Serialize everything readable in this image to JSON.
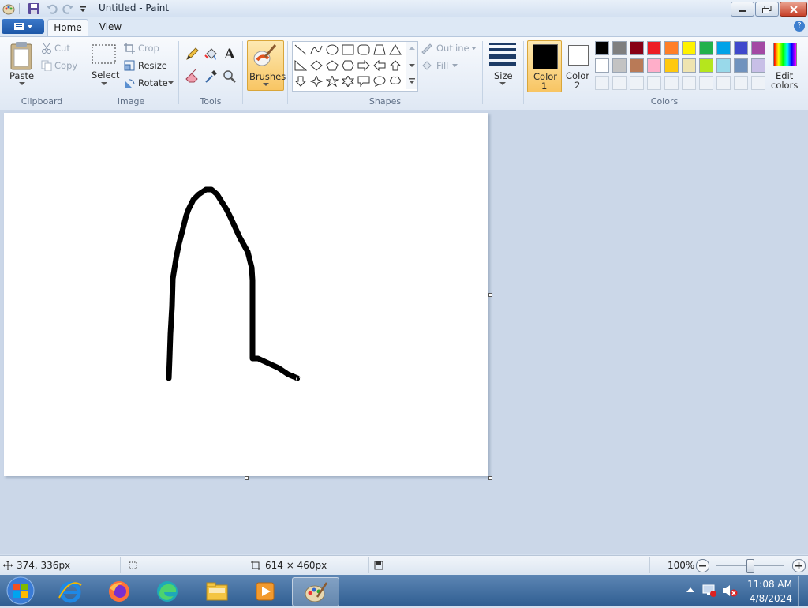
{
  "window": {
    "title": "Untitled - Paint"
  },
  "tabs": {
    "home": "Home",
    "view": "View"
  },
  "clipboard": {
    "paste": "Paste",
    "cut": "Cut",
    "copy": "Copy",
    "group": "Clipboard"
  },
  "image": {
    "select": "Select",
    "crop": "Crop",
    "resize": "Resize",
    "rotate": "Rotate",
    "group": "Image"
  },
  "tools": {
    "group": "Tools",
    "text_glyph": "A"
  },
  "brushes": {
    "label": "Brushes"
  },
  "shapes": {
    "outline": "Outline",
    "fill": "Fill",
    "group": "Shapes"
  },
  "size": {
    "label": "Size"
  },
  "colors": {
    "color1_line1": "Color",
    "color1_line2": "1",
    "color2_line1": "Color",
    "color2_line2": "2",
    "edit_line1": "Edit",
    "edit_line2": "colors",
    "group": "Colors",
    "color1": "#000000",
    "color2": "#ffffff",
    "palette_row1": [
      "#000000",
      "#7f7f7f",
      "#880015",
      "#ed1c24",
      "#ff7f27",
      "#fff200",
      "#22b14c",
      "#00a2e8",
      "#3f48cc",
      "#a349a4"
    ],
    "palette_row2": [
      "#ffffff",
      "#c3c3c3",
      "#b97a57",
      "#ffaec9",
      "#ffc90e",
      "#efe4b0",
      "#b5e61d",
      "#99d9ea",
      "#7092be",
      "#c8bfe7"
    ]
  },
  "status": {
    "cursor_pos": "374, 336px",
    "image_size": "614 × 460px",
    "zoom": "100%"
  },
  "taskbar": {
    "time": "11:08 AM",
    "date": "4/8/2024"
  }
}
